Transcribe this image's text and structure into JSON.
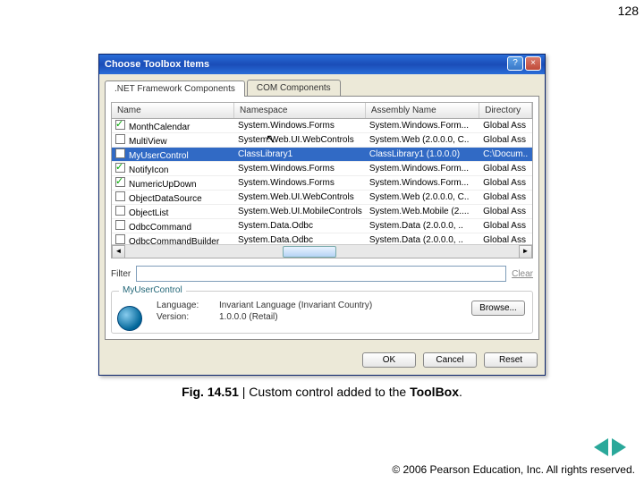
{
  "page_number": "128",
  "dialog": {
    "title": "Choose Toolbox Items",
    "tabs": [
      ".NET Framework Components",
      "COM Components"
    ],
    "columns": [
      "Name",
      "Namespace",
      "Assembly Name",
      "Directory"
    ],
    "rows": [
      {
        "checked": true,
        "sel": false,
        "cells": [
          "MonthCalendar",
          "System.Windows.Forms",
          "System.Windows.Form...",
          "Global Ass"
        ]
      },
      {
        "checked": false,
        "sel": false,
        "cells": [
          "MultiView",
          "System.Web.UI.WebControls",
          "System.Web (2.0.0.0, C..",
          "Global Ass"
        ]
      },
      {
        "checked": true,
        "sel": true,
        "cells": [
          "MyUserControl",
          "ClassLibrary1",
          "ClassLibrary1 (1.0.0.0)",
          "C:\\Docum.."
        ]
      },
      {
        "checked": true,
        "sel": false,
        "cells": [
          "NotifyIcon",
          "System.Windows.Forms",
          "System.Windows.Form...",
          "Global Ass"
        ]
      },
      {
        "checked": true,
        "sel": false,
        "cells": [
          "NumericUpDown",
          "System.Windows.Forms",
          "System.Windows.Form...",
          "Global Ass"
        ]
      },
      {
        "checked": false,
        "sel": false,
        "cells": [
          "ObjectDataSource",
          "System.Web.UI.WebControls",
          "System.Web (2.0.0.0, C..",
          "Global Ass"
        ]
      },
      {
        "checked": false,
        "sel": false,
        "cells": [
          "ObjectList",
          "System.Web.UI.MobileControls",
          "System.Web.Mobile (2....",
          "Global Ass"
        ]
      },
      {
        "checked": false,
        "sel": false,
        "cells": [
          "OdbcCommand",
          "System.Data.Odbc",
          "System.Data (2.0.0.0, ..",
          "Global Ass"
        ]
      },
      {
        "checked": false,
        "sel": false,
        "cells": [
          "OdbcCommandBuilder",
          "System.Data.Odbc",
          "System.Data (2.0.0.0, ..",
          "Global Ass"
        ]
      }
    ],
    "filter_label": "Filter",
    "clear_label": "Clear",
    "group_title": "MyUserControl",
    "info": {
      "language_label": "Language:",
      "language_value": "Invariant Language (Invariant Country)",
      "version_label": "Version:",
      "version_value": "1.0.0.0 (Retail)"
    },
    "browse_label": "Browse...",
    "buttons": {
      "ok": "OK",
      "cancel": "Cancel",
      "reset": "Reset"
    }
  },
  "caption_prefix": "Fig. 14.51",
  "caption_mid": " | Custom control added to the ",
  "caption_bold": "ToolBox",
  "caption_end": ".",
  "copyright": "© 2006 Pearson Education, Inc.  All rights reserved."
}
